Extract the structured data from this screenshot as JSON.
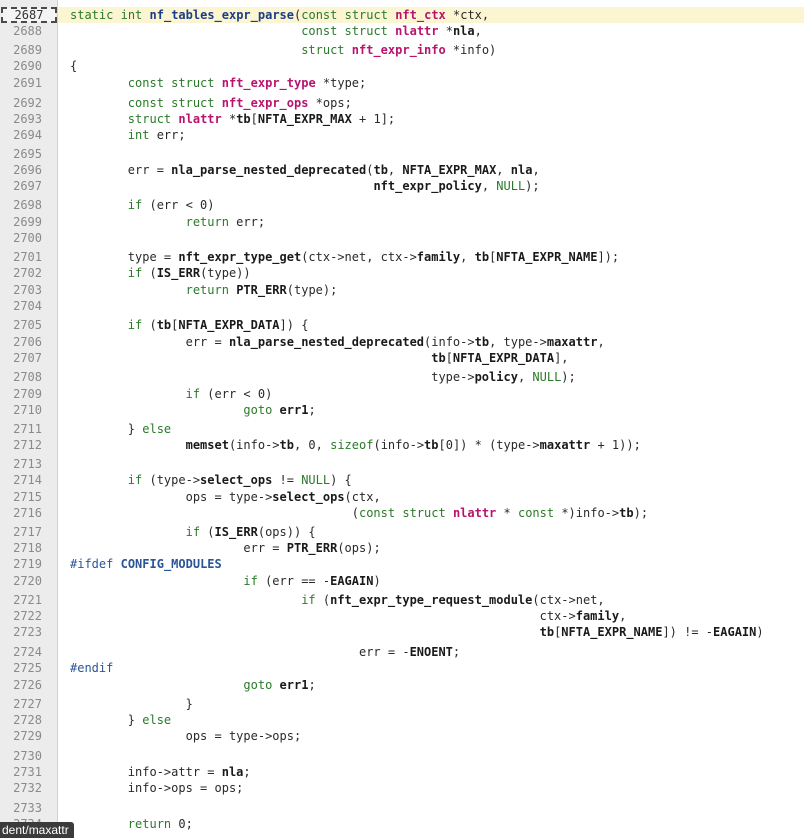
{
  "editor": {
    "active_line": "2687",
    "lines": [
      {
        "num": "2687",
        "html": "<span class=\"kw\">static</span> <span class=\"kw\">int</span> <span class=\"fnname\">nf_tables_expr_parse</span>(<span class=\"kw\">const</span> <span class=\"kw\">struct</span> <span class=\"typ\">nft_ctx</span> *ctx,"
      },
      {
        "num": "2688",
        "html": "                                <span class=\"kw\">const</span> <span class=\"kw\">struct</span> <span class=\"typ\">nlattr</span> *<span class=\"b\">nla</span>,"
      },
      {
        "num": "2689",
        "html": "                                <span class=\"kw\">struct</span> <span class=\"typ\">nft_expr_info</span> *info)"
      },
      {
        "num": "2690",
        "html": "{"
      },
      {
        "num": "2691",
        "html": "        <span class=\"kw\">const</span> <span class=\"kw\">struct</span> <span class=\"typ\">nft_expr_type</span> *type;"
      },
      {
        "num": "2692",
        "html": "        <span class=\"kw\">const</span> <span class=\"kw\">struct</span> <span class=\"typ\">nft_expr_ops</span> *ops;"
      },
      {
        "num": "2693",
        "html": "        <span class=\"kw\">struct</span> <span class=\"typ\">nlattr</span> *<span class=\"b\">tb</span>[<span class=\"b\">NFTA_EXPR_MAX</span> + 1];"
      },
      {
        "num": "2694",
        "html": "        <span class=\"kw\">int</span> err;"
      },
      {
        "num": "2695",
        "html": ""
      },
      {
        "num": "2696",
        "html": "        err = <span class=\"b\">nla_parse_nested_deprecated</span>(<span class=\"b\">tb</span>, <span class=\"b\">NFTA_EXPR_MAX</span>, <span class=\"b\">nla</span>,"
      },
      {
        "num": "2697",
        "html": "                                          <span class=\"b\">nft_expr_policy</span>, <span class=\"kw\">NULL</span>);"
      },
      {
        "num": "2698",
        "html": "        <span class=\"kw\">if</span> (err &lt; 0)"
      },
      {
        "num": "2699",
        "html": "                <span class=\"kw\">return</span> err;"
      },
      {
        "num": "2700",
        "html": ""
      },
      {
        "num": "2701",
        "html": "        type = <span class=\"b\">nft_expr_type_get</span>(ctx-&gt;net, ctx-&gt;<span class=\"b\">family</span>, <span class=\"b\">tb</span>[<span class=\"b\">NFTA_EXPR_NAME</span>]);"
      },
      {
        "num": "2702",
        "html": "        <span class=\"kw\">if</span> (<span class=\"b\">IS_ERR</span>(type))"
      },
      {
        "num": "2703",
        "html": "                <span class=\"kw\">return</span> <span class=\"b\">PTR_ERR</span>(type);"
      },
      {
        "num": "2704",
        "html": ""
      },
      {
        "num": "2705",
        "html": "        <span class=\"kw\">if</span> (<span class=\"b\">tb</span>[<span class=\"b\">NFTA_EXPR_DATA</span>]) {"
      },
      {
        "num": "2706",
        "html": "                err = <span class=\"b\">nla_parse_nested_deprecated</span>(info-&gt;<span class=\"b\">tb</span>, type-&gt;<span class=\"b\">maxattr</span>,"
      },
      {
        "num": "2707",
        "html": "                                                  <span class=\"b\">tb</span>[<span class=\"b\">NFTA_EXPR_DATA</span>],"
      },
      {
        "num": "2708",
        "html": "                                                  type-&gt;<span class=\"b\">policy</span>, <span class=\"kw\">NULL</span>);"
      },
      {
        "num": "2709",
        "html": "                <span class=\"kw\">if</span> (err &lt; 0)"
      },
      {
        "num": "2710",
        "html": "                        <span class=\"kw\">goto</span> <span class=\"b\">err1</span>;"
      },
      {
        "num": "2711",
        "html": "        } <span class=\"kw\">else</span>"
      },
      {
        "num": "2712",
        "html": "                <span class=\"b\">memset</span>(info-&gt;<span class=\"b\">tb</span>, 0, <span class=\"kw\">sizeof</span>(info-&gt;<span class=\"b\">tb</span>[0]) * (type-&gt;<span class=\"b\">maxattr</span> + 1));"
      },
      {
        "num": "2713",
        "html": ""
      },
      {
        "num": "2714",
        "html": "        <span class=\"kw\">if</span> (type-&gt;<span class=\"b\">select_ops</span> != <span class=\"kw\">NULL</span>) {"
      },
      {
        "num": "2715",
        "html": "                ops = type-&gt;<span class=\"b\">select_ops</span>(ctx,"
      },
      {
        "num": "2716",
        "html": "                                       (<span class=\"kw\">const</span> <span class=\"kw\">struct</span> <span class=\"typ\">nlattr</span> * <span class=\"kw\">const</span> *)info-&gt;<span class=\"b\">tb</span>);"
      },
      {
        "num": "2717",
        "html": "                <span class=\"kw\">if</span> (<span class=\"b\">IS_ERR</span>(ops)) {"
      },
      {
        "num": "2718",
        "html": "                        err = <span class=\"b\">PTR_ERR</span>(ops);"
      },
      {
        "num": "2719",
        "html": "<span class=\"pp\">#ifdef</span> <span class=\"macro\">CONFIG_MODULES</span>"
      },
      {
        "num": "2720",
        "html": "                        <span class=\"kw\">if</span> (err == -<span class=\"b\">EAGAIN</span>)"
      },
      {
        "num": "2721",
        "html": "                                <span class=\"kw\">if</span> (<span class=\"b\">nft_expr_type_request_module</span>(ctx-&gt;net,"
      },
      {
        "num": "2722",
        "html": "                                                                 ctx-&gt;<span class=\"b\">family</span>,"
      },
      {
        "num": "2723",
        "html": "                                                                 <span class=\"b\">tb</span>[<span class=\"b\">NFTA_EXPR_NAME</span>]) != -<span class=\"b\">EAGAIN</span>)"
      },
      {
        "num": "2724",
        "html": "                                        err = -<span class=\"b\">ENOENT</span>;"
      },
      {
        "num": "2725",
        "html": "<span class=\"pp\">#endif</span>"
      },
      {
        "num": "2726",
        "html": "                        <span class=\"kw\">goto</span> <span class=\"b\">err1</span>;"
      },
      {
        "num": "2727",
        "html": "                }"
      },
      {
        "num": "2728",
        "html": "        } <span class=\"kw\">else</span>"
      },
      {
        "num": "2729",
        "html": "                ops = type-&gt;ops;"
      },
      {
        "num": "2730",
        "html": ""
      },
      {
        "num": "2731",
        "html": "        info-&gt;attr = <span class=\"b\">nla</span>;"
      },
      {
        "num": "2732",
        "html": "        info-&gt;ops = ops;"
      },
      {
        "num": "2733",
        "html": ""
      },
      {
        "num": "2734",
        "html": "        <span class=\"kw\">return</span> 0;"
      }
    ]
  },
  "status_tip": "dent/maxattr",
  "colors": {
    "keyword": "#2a7a2a",
    "function_name": "#1c3d8a",
    "type_name": "#b8146e",
    "preprocessor": "#2b5596",
    "line_highlight": "#fbf5d2",
    "gutter_bg": "#ececec"
  }
}
